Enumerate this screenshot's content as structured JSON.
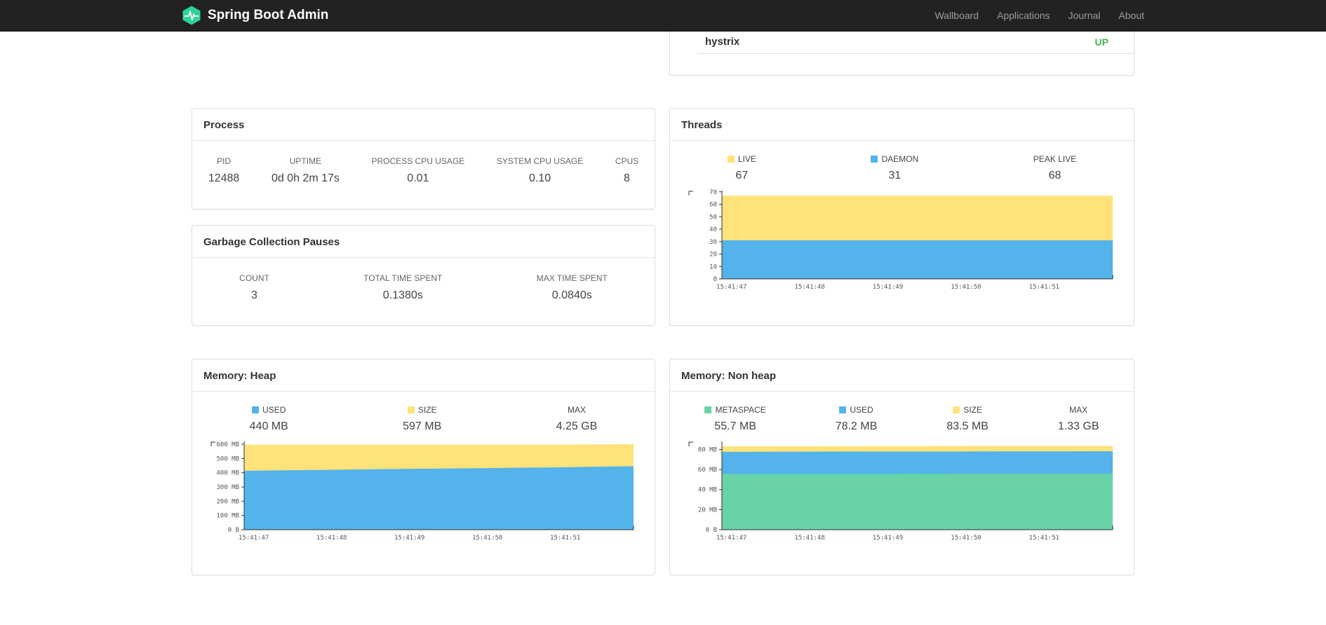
{
  "navbar": {
    "brand": "Spring Boot Admin",
    "items": [
      {
        "label": "Wallboard"
      },
      {
        "label": "Applications"
      },
      {
        "label": "Journal"
      },
      {
        "label": "About"
      }
    ]
  },
  "health": {
    "rows": [
      {
        "name": "hystrix",
        "status": "UP",
        "status_color": "#4caf50"
      }
    ]
  },
  "panels": {
    "process": {
      "title": "Process",
      "metrics": [
        {
          "label": "PID",
          "value": "12488"
        },
        {
          "label": "UPTIME",
          "value": "0d 0h 2m 17s"
        },
        {
          "label": "PROCESS CPU USAGE",
          "value": "0.01"
        },
        {
          "label": "SYSTEM CPU USAGE",
          "value": "0.10"
        },
        {
          "label": "CPUS",
          "value": "8"
        }
      ]
    },
    "gc": {
      "title": "Garbage Collection Pauses",
      "metrics": [
        {
          "label": "COUNT",
          "value": "3"
        },
        {
          "label": "TOTAL TIME SPENT",
          "value": "0.1380s"
        },
        {
          "label": "MAX TIME SPENT",
          "value": "0.0840s"
        }
      ]
    },
    "threads": {
      "title": "Threads",
      "legend": [
        {
          "label": "LIVE",
          "value": "67",
          "color": "#ffe27a"
        },
        {
          "label": "DAEMON",
          "value": "31",
          "color": "#53b3ea"
        },
        {
          "label": "PEAK LIVE",
          "value": "68",
          "color": ""
        }
      ]
    },
    "memory_heap": {
      "title": "Memory: Heap",
      "legend": [
        {
          "label": "USED",
          "value": "440 MB",
          "color": "#53b3ea"
        },
        {
          "label": "SIZE",
          "value": "597 MB",
          "color": "#ffe27a"
        },
        {
          "label": "MAX",
          "value": "4.25 GB",
          "color": ""
        }
      ]
    },
    "memory_nonheap": {
      "title": "Memory: Non heap",
      "legend": [
        {
          "label": "METASPACE",
          "value": "55.7 MB",
          "color": "#69d3a7"
        },
        {
          "label": "USED",
          "value": "78.2 MB",
          "color": "#53b3ea"
        },
        {
          "label": "SIZE",
          "value": "83.5 MB",
          "color": "#ffe27a"
        },
        {
          "label": "MAX",
          "value": "1.33 GB",
          "color": ""
        }
      ]
    }
  },
  "chart_data": [
    {
      "id": "threads",
      "type": "area",
      "title": "Threads",
      "x_labels": [
        "15:41:47",
        "15:41:48",
        "15:41:49",
        "15:41:50",
        "15:41:51"
      ],
      "ylim": [
        0,
        71
      ],
      "yticks": [
        [
          0,
          "0"
        ],
        [
          10,
          "10"
        ],
        [
          20,
          "20"
        ],
        [
          30,
          "30"
        ],
        [
          40,
          "40"
        ],
        [
          50,
          "50"
        ],
        [
          60,
          "60"
        ],
        [
          70,
          "70"
        ]
      ],
      "legend_position": "top",
      "grid": false,
      "series": [
        {
          "name": "LIVE",
          "color": "#ffe27a",
          "values": [
            67,
            67,
            67,
            67,
            67,
            67
          ]
        },
        {
          "name": "DAEMON",
          "color": "#53b3ea",
          "values": [
            31,
            31,
            31,
            31,
            31,
            31
          ]
        }
      ]
    },
    {
      "id": "memory_heap",
      "type": "area",
      "title": "Memory: Heap",
      "x_labels": [
        "15:41:47",
        "15:41:48",
        "15:41:49",
        "15:41:50",
        "15:41:51"
      ],
      "ylim": [
        0,
        620
      ],
      "yticks": [
        [
          0,
          "0 B"
        ],
        [
          100,
          "100 MB"
        ],
        [
          200,
          "200 MB"
        ],
        [
          300,
          "300 MB"
        ],
        [
          400,
          "400 MB"
        ],
        [
          500,
          "500 MB"
        ],
        [
          600,
          "600 MB"
        ]
      ],
      "legend_position": "top",
      "grid": false,
      "series": [
        {
          "name": "SIZE",
          "color": "#ffe27a",
          "values": [
            597,
            597,
            597,
            597,
            597,
            601
          ]
        },
        {
          "name": "USED",
          "color": "#53b3ea",
          "values": [
            414,
            420,
            427,
            432,
            438,
            446
          ]
        }
      ]
    },
    {
      "id": "memory_nonheap",
      "type": "area",
      "title": "Memory: Non heap",
      "x_labels": [
        "15:41:47",
        "15:41:48",
        "15:41:49",
        "15:41:50",
        "15:41:51"
      ],
      "ylim": [
        0,
        88
      ],
      "yticks": [
        [
          0,
          "0 B"
        ],
        [
          20,
          "20 MB"
        ],
        [
          40,
          "40 MB"
        ],
        [
          60,
          "60 MB"
        ],
        [
          80,
          "80 MB"
        ]
      ],
      "legend_position": "top",
      "grid": false,
      "series": [
        {
          "name": "SIZE",
          "color": "#ffe27a",
          "values": [
            83.0,
            83.2,
            83.3,
            83.4,
            83.5,
            83.5
          ]
        },
        {
          "name": "USED",
          "color": "#53b3ea",
          "values": [
            77.6,
            77.8,
            78.0,
            78.0,
            78.1,
            78.2
          ]
        },
        {
          "name": "METASPACE",
          "color": "#69d3a7",
          "values": [
            55.5,
            55.6,
            55.6,
            55.7,
            55.7,
            55.7
          ]
        }
      ]
    }
  ]
}
